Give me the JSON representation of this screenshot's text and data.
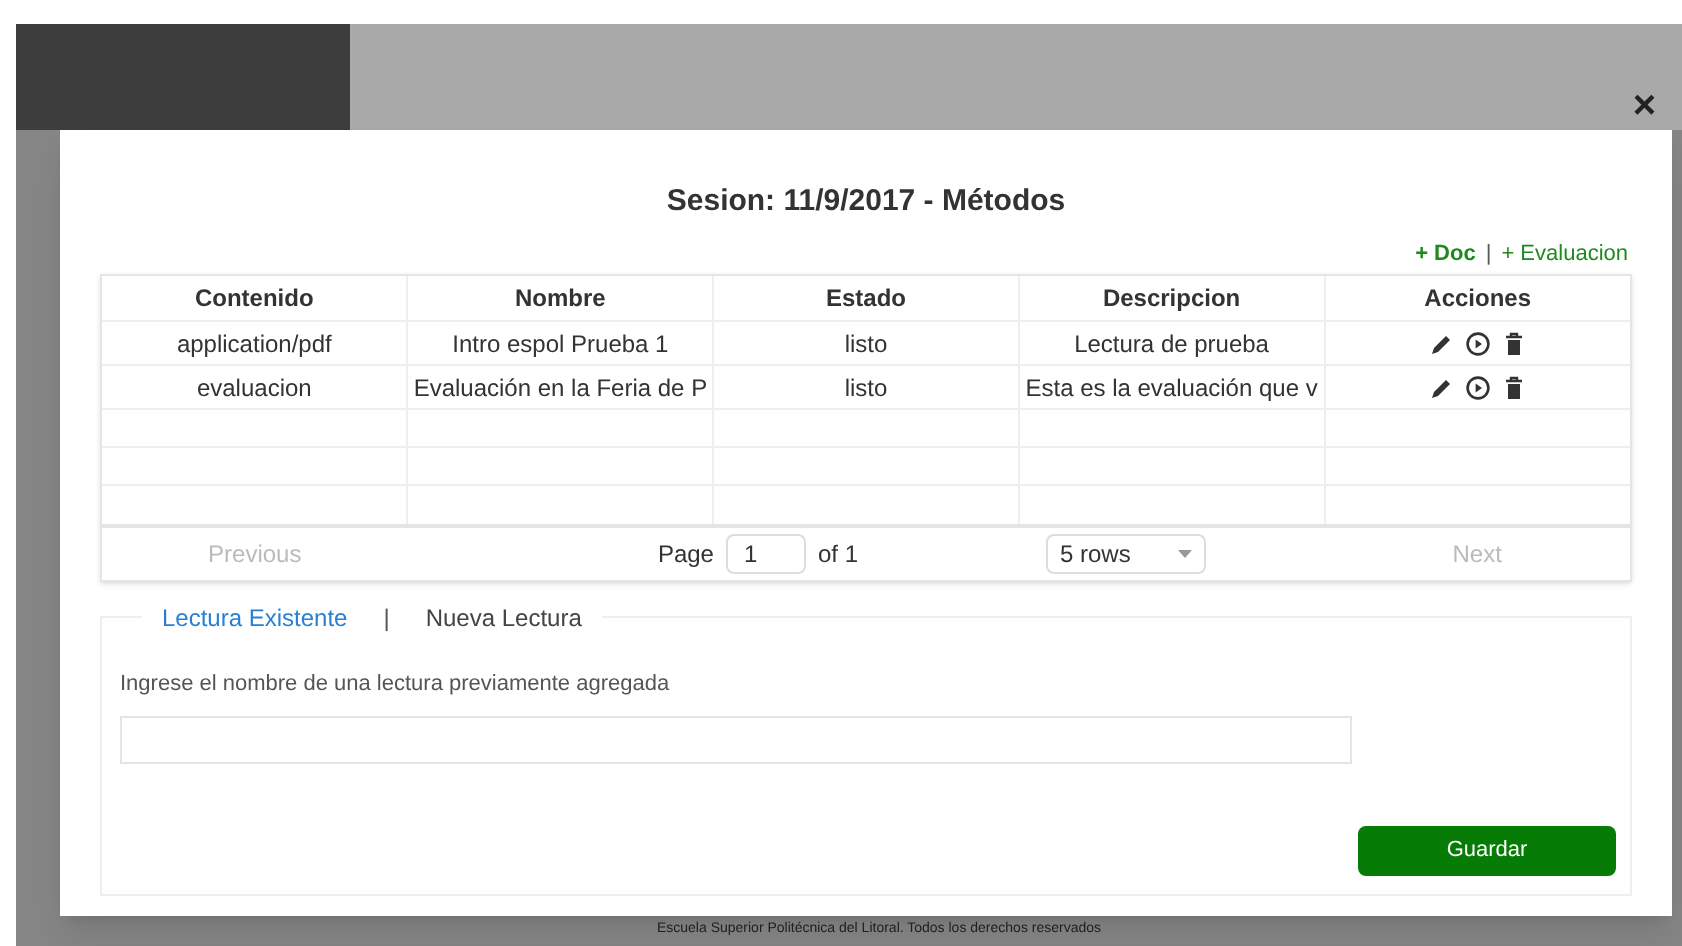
{
  "modal": {
    "title": "Sesion: 11/9/2017 - Métodos",
    "close": "×",
    "links": [
      {
        "label": "+ Doc",
        "bold": true
      },
      {
        "label": "+ Evaluacion",
        "bold": false
      }
    ],
    "link_separator": "|",
    "table": {
      "columns": [
        "Contenido",
        "Nombre",
        "Estado",
        "Descripcion",
        "Acciones"
      ],
      "rows": [
        {
          "cells": [
            "application/pdf",
            "Intro espol Prueba 1",
            "listo",
            "Lectura de prueba"
          ]
        },
        {
          "cells": [
            "evaluacion",
            "Evaluación en la Feria de P",
            "listo",
            "Esta es la evaluación que v"
          ]
        }
      ],
      "pagination": {
        "previous": {
          "label": "Previous",
          "disabled": true
        },
        "page_label": "Page",
        "page": "1",
        "of": "of 1",
        "page_size": "5 rows",
        "next": {
          "label": "Next",
          "disabled": true
        }
      }
    },
    "tabs": [
      {
        "label": "Lectura Existente",
        "selected": true
      },
      {
        "label": "Nueva Lectura",
        "selected": false
      }
    ],
    "tab_separator": "|",
    "field": {
      "label": "Ingrese el nombre de una lectura previamente agregada"
    },
    "save_button": "Guardar"
  },
  "footer": "Escuela Superior Politécnica del Litoral. Todos los derechos reservados"
}
